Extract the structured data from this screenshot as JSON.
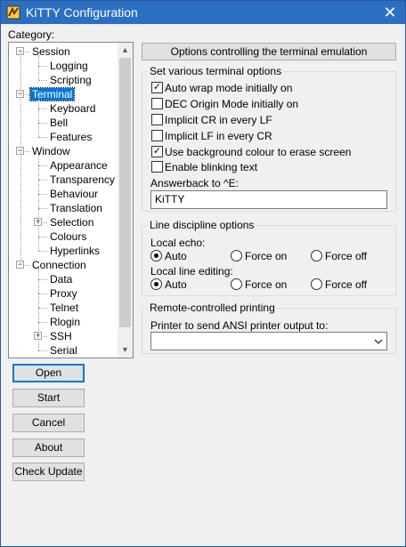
{
  "window": {
    "title": "KiTTY Configuration",
    "close_glyph": "✕"
  },
  "category_label": "Category:",
  "tree": {
    "items": [
      {
        "label": "Session",
        "level": 0,
        "expander": "−"
      },
      {
        "label": "Logging",
        "level": 1
      },
      {
        "label": "Scripting",
        "level": 1
      },
      {
        "label": "Terminal",
        "level": 0,
        "expander": "−",
        "selected": true
      },
      {
        "label": "Keyboard",
        "level": 1
      },
      {
        "label": "Bell",
        "level": 1
      },
      {
        "label": "Features",
        "level": 1
      },
      {
        "label": "Window",
        "level": 0,
        "expander": "−"
      },
      {
        "label": "Appearance",
        "level": 1
      },
      {
        "label": "Transparency",
        "level": 1
      },
      {
        "label": "Behaviour",
        "level": 1
      },
      {
        "label": "Translation",
        "level": 1
      },
      {
        "label": "Selection",
        "level": 1,
        "expander": "+"
      },
      {
        "label": "Colours",
        "level": 1
      },
      {
        "label": "Hyperlinks",
        "level": 1
      },
      {
        "label": "Connection",
        "level": 0,
        "expander": "−"
      },
      {
        "label": "Data",
        "level": 1
      },
      {
        "label": "Proxy",
        "level": 1
      },
      {
        "label": "Telnet",
        "level": 1
      },
      {
        "label": "Rlogin",
        "level": 1
      },
      {
        "label": "SSH",
        "level": 1,
        "expander": "+"
      },
      {
        "label": "Serial",
        "level": 1
      }
    ]
  },
  "buttons": {
    "open": "Open",
    "start": "Start",
    "cancel": "Cancel",
    "about": "About",
    "check_update": "Check Update"
  },
  "panel": {
    "header": "Options controlling the terminal emulation",
    "terminal_options": {
      "title": "Set various terminal options",
      "checkboxes": [
        {
          "label": "Auto wrap mode initially on",
          "checked": true
        },
        {
          "label": "DEC Origin Mode initially on",
          "checked": false
        },
        {
          "label": "Implicit CR in every LF",
          "checked": false
        },
        {
          "label": "Implicit LF in every CR",
          "checked": false
        },
        {
          "label": "Use background colour to erase screen",
          "checked": true
        },
        {
          "label": "Enable blinking text",
          "checked": false
        }
      ],
      "answerback_label": "Answerback to ^E:",
      "answerback_value": "KiTTY"
    },
    "line_discipline": {
      "title": "Line discipline options",
      "local_echo_label": "Local echo:",
      "local_editing_label": "Local line editing:",
      "options": [
        "Auto",
        "Force on",
        "Force off"
      ],
      "local_echo_selected": "Auto",
      "local_editing_selected": "Auto"
    },
    "printing": {
      "title": "Remote-controlled printing",
      "printer_label": "Printer to send ANSI printer output to:",
      "printer_value": ""
    }
  },
  "colors": {
    "titlebar": "#2b6fc3",
    "selection": "#0078d7"
  }
}
